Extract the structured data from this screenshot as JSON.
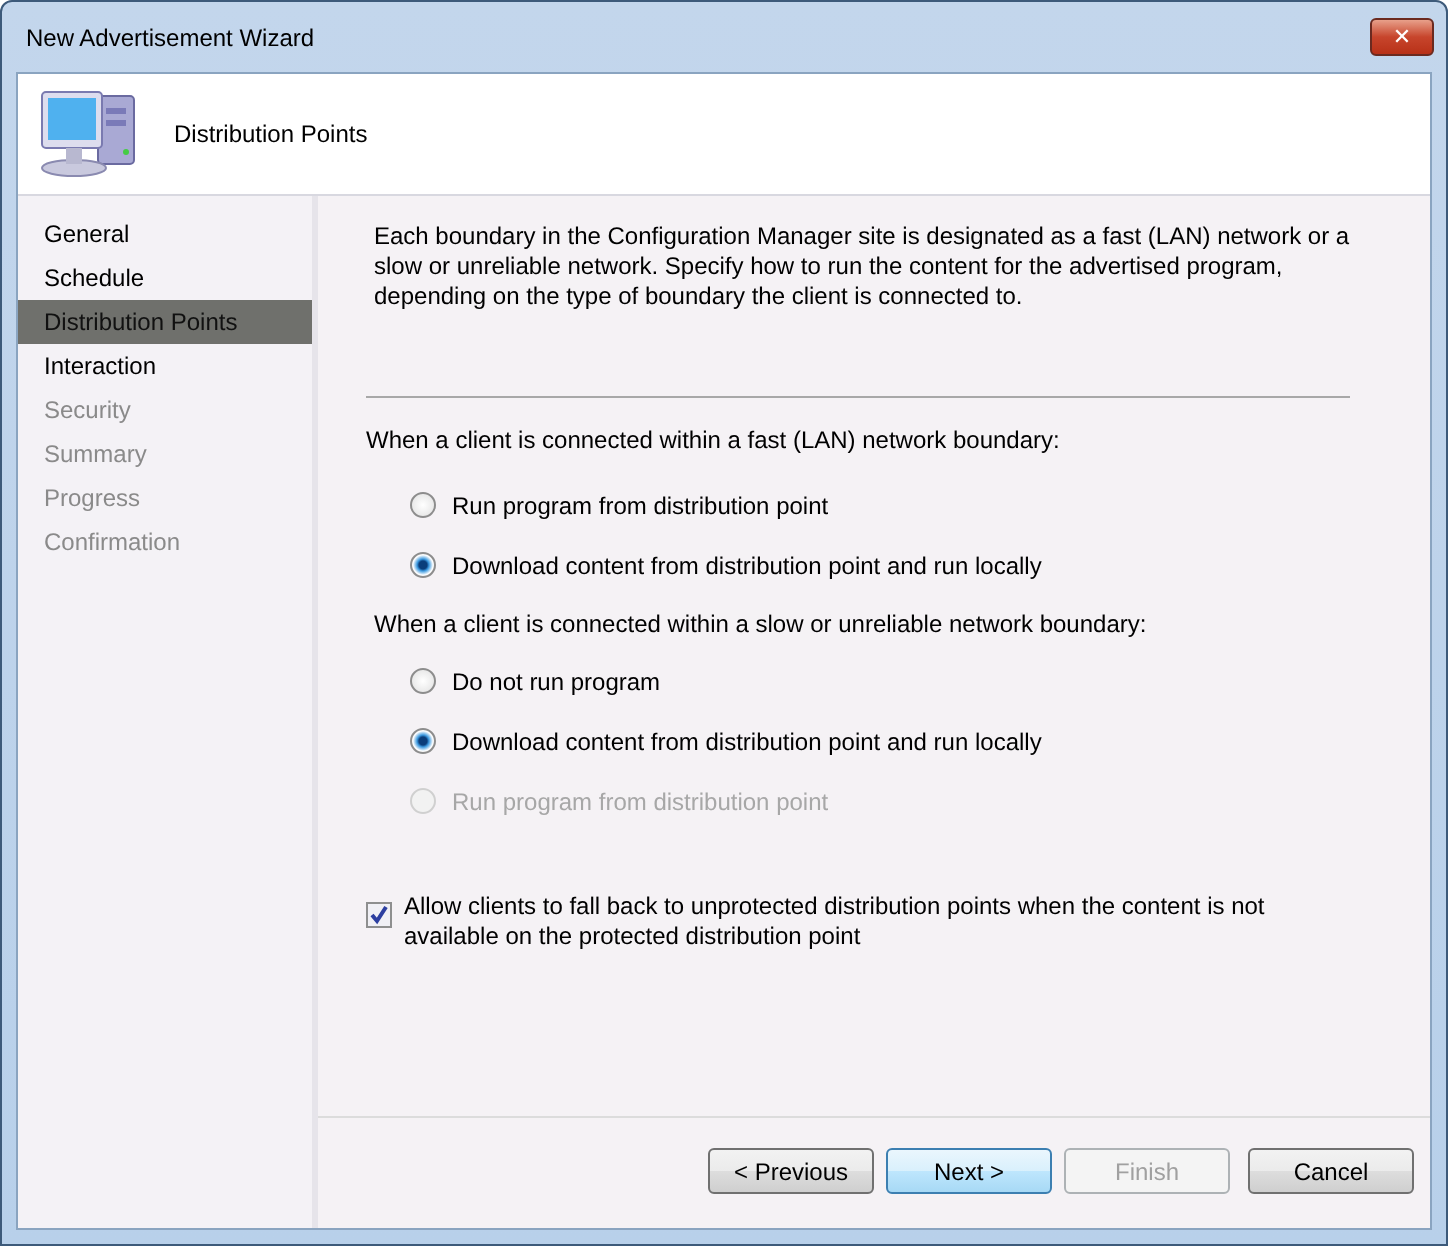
{
  "window": {
    "title": "New Advertisement Wizard",
    "close": "✕"
  },
  "header": {
    "title": "Distribution Points"
  },
  "sidebar": {
    "items": [
      {
        "label": "General",
        "selected": false,
        "disabled": false
      },
      {
        "label": "Schedule",
        "selected": false,
        "disabled": false
      },
      {
        "label": "Distribution Points",
        "selected": true,
        "disabled": false
      },
      {
        "label": "Interaction",
        "selected": false,
        "disabled": false
      },
      {
        "label": "Security",
        "selected": false,
        "disabled": true
      },
      {
        "label": "Summary",
        "selected": false,
        "disabled": true
      },
      {
        "label": "Progress",
        "selected": false,
        "disabled": true
      },
      {
        "label": "Confirmation",
        "selected": false,
        "disabled": true
      }
    ]
  },
  "description": "Each boundary in the Configuration Manager site is designated as a fast (LAN) network or a slow or unreliable network. Specify how to run the content for the advertised program, depending on the type of boundary the client is connected to.",
  "groups": [
    {
      "label": "When a client is connected within a fast (LAN) network boundary:",
      "options": [
        {
          "label": "Run program from distribution point",
          "selected": false,
          "disabled": false
        },
        {
          "label": "Download content from distribution point and run locally",
          "selected": true,
          "disabled": false
        }
      ]
    },
    {
      "label": "When a client is connected within a slow or unreliable network boundary:",
      "options": [
        {
          "label": "Do not run program",
          "selected": false,
          "disabled": false
        },
        {
          "label": "Download content from distribution point and run locally",
          "selected": true,
          "disabled": false
        },
        {
          "label": "Run program from distribution point",
          "selected": false,
          "disabled": true
        }
      ]
    }
  ],
  "fallback": {
    "label": "Allow clients to fall back to unprotected distribution points when the content is not available on the protected distribution point",
    "checked": true
  },
  "buttons": [
    {
      "label": "< Previous",
      "disabled": false,
      "default": false
    },
    {
      "label": "Next >",
      "disabled": false,
      "default": true
    },
    {
      "label": "Finish",
      "disabled": true,
      "default": false
    },
    {
      "label": "Cancel",
      "disabled": false,
      "default": false
    }
  ]
}
